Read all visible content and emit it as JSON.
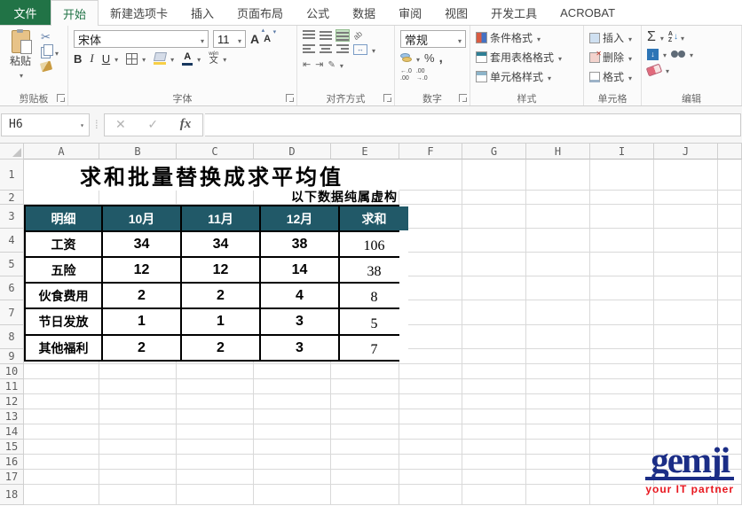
{
  "tabs": {
    "file_label": "文件",
    "selected": "开始",
    "items": [
      "开始",
      "新建选项卡",
      "插入",
      "页面布局",
      "公式",
      "数据",
      "审阅",
      "视图",
      "开发工具",
      "ACROBAT"
    ]
  },
  "ribbon": {
    "clipboard": {
      "group_label": "剪贴板",
      "paste_label": "粘贴"
    },
    "font": {
      "group_label": "字体",
      "family": "宋体",
      "size": "11",
      "bold_label": "B",
      "italic_label": "I",
      "underline_label": "U",
      "grow_label": "A",
      "shrink_label": "A",
      "phonetic_top": "wén",
      "phonetic_char": "文"
    },
    "alignment": {
      "group_label": "对齐方式",
      "orientation_label": "ab"
    },
    "number": {
      "group_label": "数字",
      "format_value": "常规",
      "percent_label": "%",
      "comma_label": ",",
      "increase_decimal": "←.0\n.00",
      "decrease_decimal": ".00\n→.0"
    },
    "styles": {
      "group_label": "样式",
      "conditional_label": "条件格式",
      "format_table_label": "套用表格格式",
      "cell_styles_label": "单元格样式"
    },
    "cells": {
      "group_label": "单元格",
      "insert_label": "插入",
      "delete_label": "删除",
      "format_label": "格式"
    },
    "editing": {
      "group_label": "编辑",
      "autosum_label": "Σ",
      "sort_a": "A",
      "sort_z": "Z",
      "fill_arrow": "↓"
    }
  },
  "formula_bar": {
    "cell_ref": "H6",
    "fx_label": "fx",
    "formula_value": ""
  },
  "sheet": {
    "column_headers": [
      "A",
      "B",
      "C",
      "D",
      "E",
      "F",
      "G",
      "H",
      "I",
      "J"
    ],
    "row_headers": [
      "1",
      "2",
      "3",
      "4",
      "5",
      "6",
      "7",
      "8",
      "9",
      "10",
      "11",
      "12",
      "13",
      "14",
      "15",
      "16",
      "17",
      "18"
    ],
    "title": "求和批量替换成求平均值",
    "subtitle": "以下数据纯属虚构",
    "table": {
      "headers": [
        "明细",
        "10月",
        "11月",
        "12月",
        "求和"
      ],
      "rows": [
        [
          "工资",
          "34",
          "34",
          "38",
          "106"
        ],
        [
          "五险",
          "12",
          "12",
          "14",
          "38"
        ],
        [
          "伙食费用",
          "2",
          "2",
          "4",
          "8"
        ],
        [
          "节日发放",
          "1",
          "1",
          "3",
          "5"
        ],
        [
          "其他福利",
          "2",
          "2",
          "3",
          "7"
        ]
      ]
    }
  },
  "watermark": {
    "name": "gemji",
    "tagline": "your IT partner"
  },
  "colors": {
    "excel_green": "#217346",
    "table_header_bg": "#215968",
    "logo_blue": "#1b2d86",
    "tagline_red": "#e8151d",
    "selected_align_bg": "#c8e3c5",
    "gridline": "#d9d9d9"
  }
}
